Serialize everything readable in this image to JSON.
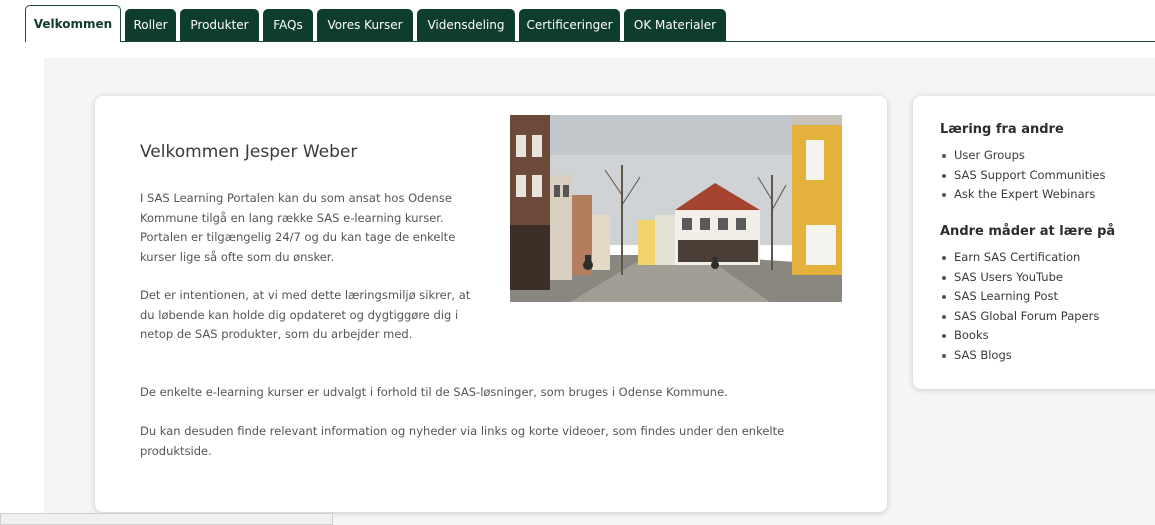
{
  "tabs": [
    {
      "label": "Velkommen",
      "active": true
    },
    {
      "label": "Roller"
    },
    {
      "label": "Produkter"
    },
    {
      "label": "FAQs"
    },
    {
      "label": "Vores Kurser"
    },
    {
      "label": "Vidensdeling"
    },
    {
      "label": "Certificeringer"
    },
    {
      "label": "OK Materialer"
    }
  ],
  "main": {
    "heading": "Velkommen Jesper Weber",
    "paragraph1": "I SAS Learning Portalen kan du som ansat hos Odense Kommune tilgå en lang række SAS e-learning kurser. Portalen er tilgængelig 24/7 og du kan tage de enkelte kurser lige så ofte som du ønsker.",
    "paragraph2": "Det er intentionen, at vi med dette læringsmiljø sikrer, at du løbende kan holde dig opdateret og dygtiggøre dig i netop de SAS produkter, som du arbejder med.",
    "paragraph3": "De enkelte e-learning kurser er udvalgt i forhold til de SAS-løsninger, som bruges i Odense Kommune.",
    "paragraph4": "Du kan desuden finde relevant information og nyheder via links og korte videoer, som findes under den enkelte produktside."
  },
  "sidebar": {
    "section1_title": "Læring fra andre",
    "section1_items": [
      "User Groups",
      "SAS Support Communities",
      "Ask the Expert Webinars"
    ],
    "section2_title": "Andre måder at lære på",
    "section2_items": [
      "Earn SAS Certification",
      "SAS Users YouTube",
      "SAS Learning Post",
      "SAS Global Forum Papers",
      "Books",
      "SAS Blogs"
    ]
  },
  "colors": {
    "tab_bg": "#0f3d2b",
    "content_bg": "#f5f5f5"
  }
}
